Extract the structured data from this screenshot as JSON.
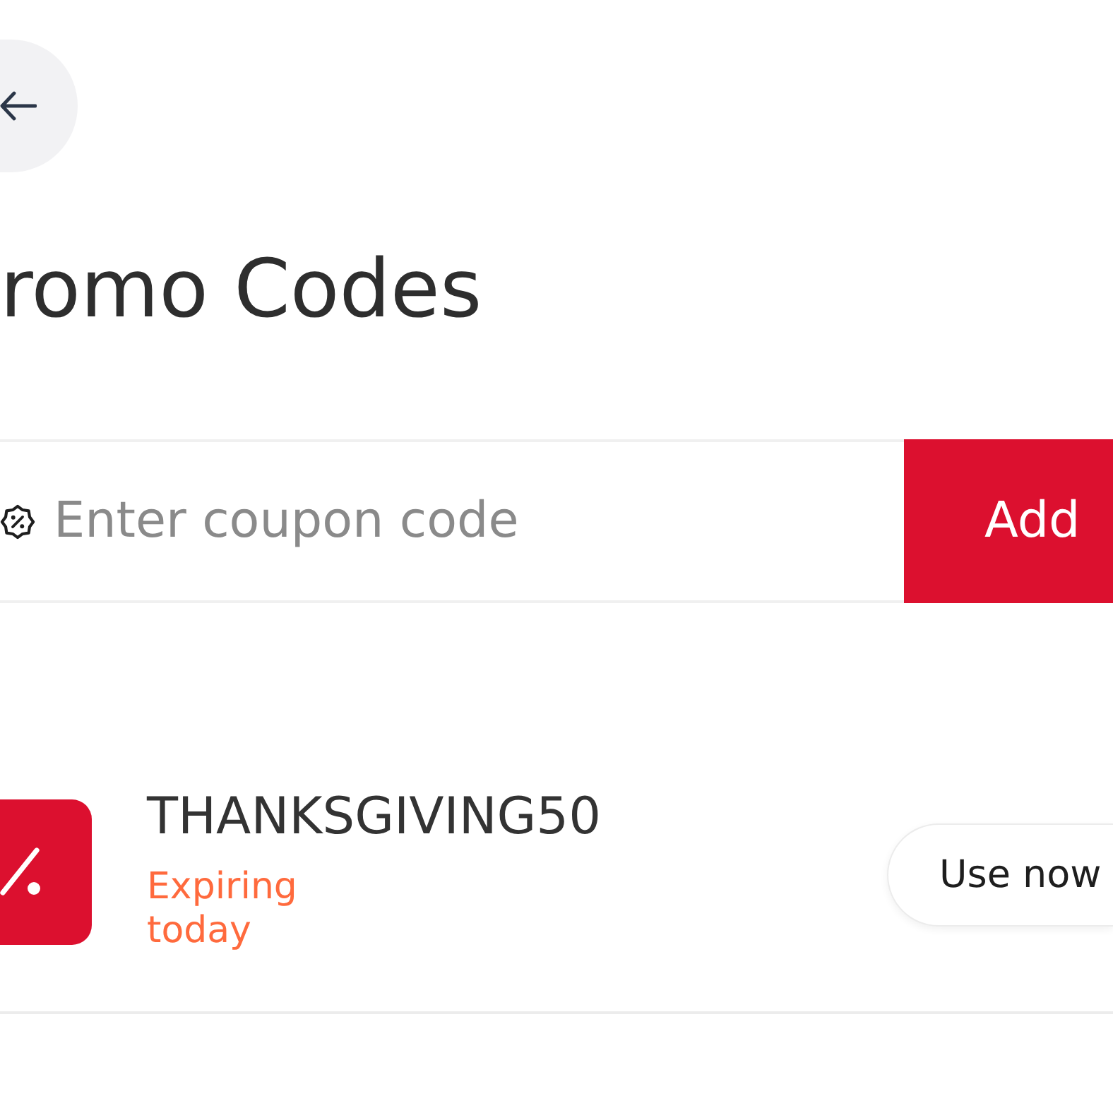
{
  "title": "romo Codes",
  "coupon_input": {
    "placeholder": "Enter coupon code",
    "button": "Add"
  },
  "promos": [
    {
      "code": "THANKSGIVING50",
      "status": "Expiring today",
      "action": "Use now"
    }
  ]
}
